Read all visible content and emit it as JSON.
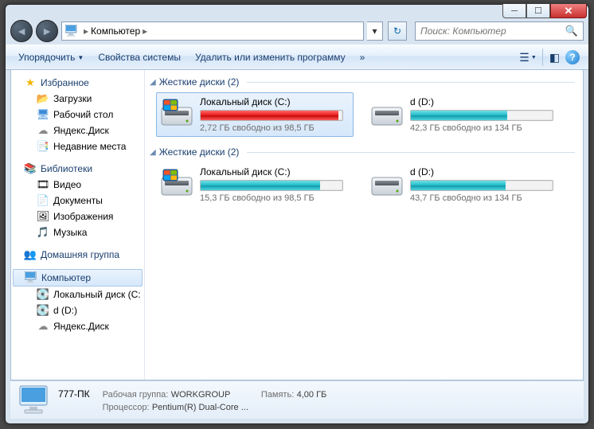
{
  "window": {
    "title": "Компьютер"
  },
  "nav": {
    "crumb_root": "Компьютер",
    "search_placeholder": "Поиск: Компьютер"
  },
  "toolbar": {
    "organize": "Упорядочить",
    "props": "Свойства системы",
    "uninstall": "Удалить или изменить программу",
    "more": "»"
  },
  "sidebar": {
    "favorites": {
      "title": "Избранное",
      "items": [
        "Загрузки",
        "Рабочий стол",
        "Яндекс.Диск",
        "Недавние места"
      ]
    },
    "libraries": {
      "title": "Библиотеки",
      "items": [
        "Видео",
        "Документы",
        "Изображения",
        "Музыка"
      ]
    },
    "homegroup": {
      "title": "Домашняя группа"
    },
    "computer": {
      "title": "Компьютер",
      "items": [
        "Локальный диск (C:)",
        "d (D:)",
        "Яндекс.Диск"
      ]
    }
  },
  "content": {
    "groups": [
      {
        "title": "Жесткие диски (2)",
        "drives": [
          {
            "name": "Локальный диск (C:)",
            "free": "2,72 ГБ свободно из 98,5 ГБ",
            "pct": 97,
            "color": "red",
            "selected": true
          },
          {
            "name": "d (D:)",
            "free": "42,3 ГБ свободно из 134 ГБ",
            "pct": 68,
            "color": "teal",
            "selected": false
          }
        ]
      },
      {
        "title": "Жесткие диски (2)",
        "drives": [
          {
            "name": "Локальный диск (C:)",
            "free": "15,3 ГБ свободно из 98,5 ГБ",
            "pct": 84,
            "color": "teal",
            "selected": false
          },
          {
            "name": "d (D:)",
            "free": "43,7 ГБ свободно из 134 ГБ",
            "pct": 67,
            "color": "teal",
            "selected": false
          }
        ]
      }
    ]
  },
  "details": {
    "name": "777-ПК",
    "workgroup_label": "Рабочая группа:",
    "workgroup": "WORKGROUP",
    "memory_label": "Память:",
    "memory": "4,00 ГБ",
    "cpu_label": "Процессор:",
    "cpu": "Pentium(R) Dual-Core  ..."
  }
}
